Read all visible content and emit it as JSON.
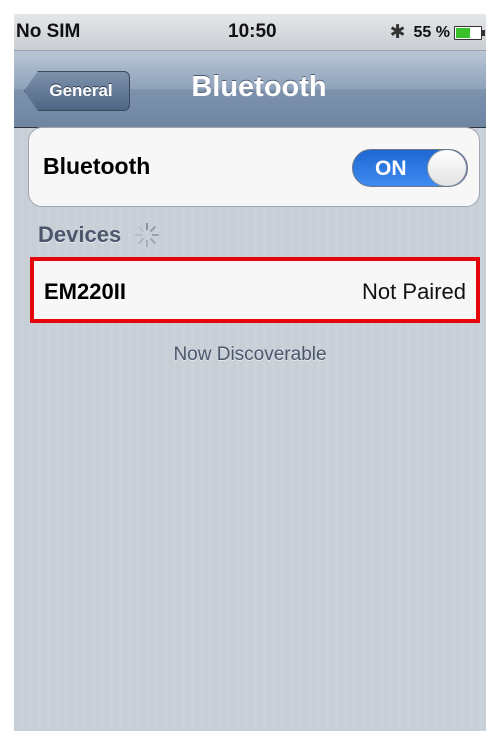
{
  "status_bar": {
    "carrier": "No SIM",
    "time": "10:50",
    "bluetooth_icon": "bluetooth-icon",
    "battery_percent": "55 %",
    "battery_level": 0.55
  },
  "nav": {
    "back_label": "General",
    "title": "Bluetooth"
  },
  "bluetooth_row": {
    "label": "Bluetooth",
    "toggle_state": "ON"
  },
  "devices_section": {
    "header": "Devices",
    "spinner_icon": "loading-spinner-icon"
  },
  "devices": [
    {
      "name": "EM220II",
      "status": "Not Paired"
    }
  ],
  "footer": {
    "text": "Now Discoverable"
  },
  "colors": {
    "toggle_on": "#1f68d4",
    "highlight_border": "#e5060b",
    "battery_fill": "#38c12a"
  }
}
